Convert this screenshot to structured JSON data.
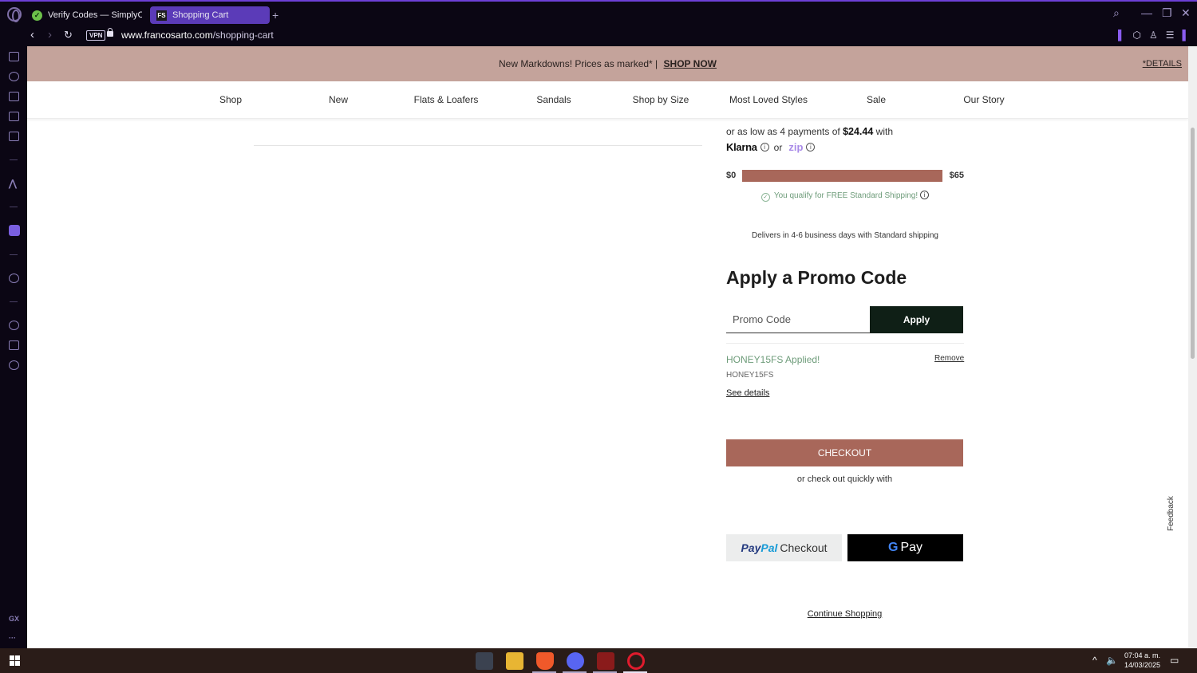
{
  "browser": {
    "tabs": [
      {
        "title": "Verify Codes — SimplyCodes",
        "icon": "simplycodes-check-icon",
        "active": false
      },
      {
        "title": "Shopping Cart",
        "icon": "fs-favicon-icon",
        "badge": "FS",
        "active": true
      }
    ],
    "url_domain": "www.francosarto.com",
    "url_path": "/shopping-cart",
    "vpn_label": "VPN"
  },
  "site": {
    "banner_text": "New Markdowns! Prices as marked* |",
    "banner_cta": "SHOP NOW",
    "banner_details": "*DETAILS",
    "nav": [
      "Shop",
      "New",
      "Flats & Loafers",
      "Sandals",
      "Shop by Size",
      "Most Loved Styles",
      "Sale",
      "Our Story"
    ]
  },
  "cart": {
    "installments_prefix": "or as low as 4 payments of",
    "installment_amount": "$24.44",
    "installments_suffix": "with",
    "klarna_label": "Klarna",
    "or_label": "or",
    "zip_label": "zip",
    "shipping_min": "$0",
    "shipping_max": "$65",
    "shipping_progress_percent": 100,
    "shipping_qualify": "You qualify for FREE Standard Shipping!",
    "delivers": "Delivers in 4-6 business days with Standard shipping",
    "promo_title": "Apply a Promo Code",
    "promo_placeholder": "Promo Code",
    "apply_label": "Apply",
    "applied_text": "HONEY15FS Applied!",
    "remove_label": "Remove",
    "applied_code": "HONEY15FS",
    "see_details": "See details",
    "checkout_label": "CHECKOUT",
    "quick_checkout": "or check out quickly with",
    "paypal_brand_1": "Pay",
    "paypal_brand_2": "Pal",
    "paypal_checkout": "Checkout",
    "gpay_g": "G",
    "gpay_label": "Pay",
    "continue_label": "Continue Shopping",
    "feedback_label": "Feedback"
  },
  "taskbar": {
    "time": "07:04 a. m.",
    "date": "14/03/2025"
  },
  "colors": {
    "brand_accent": "#a8675a",
    "banner_bg": "#c4a39b",
    "success_green": "#6e9c7a",
    "apply_btn": "#0f1f16",
    "opera_purple": "#5b3bb8"
  }
}
